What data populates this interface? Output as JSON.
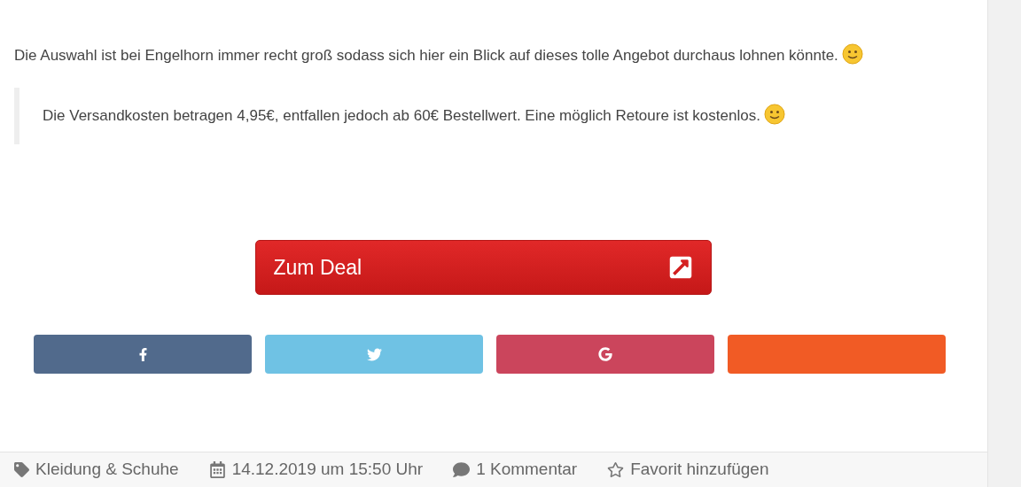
{
  "paragraph": {
    "text": "Die Auswahl ist bei Engelhorn immer recht groß sodass sich hier ein Blick auf dieses tolle Angebot durchaus lohnen könnte."
  },
  "quote": {
    "text": "Die Versandkosten betragen 4,95€, entfallen jedoch ab 60€ Bestellwert. Eine möglich Retoure ist kostenlos."
  },
  "deal_button": {
    "label": "Zum Deal"
  },
  "share_buttons": [
    {
      "kind": "facebook",
      "color": "#516a8c"
    },
    {
      "kind": "twitter",
      "color": "#6fc2e4"
    },
    {
      "kind": "google",
      "color": "#cb455c"
    },
    {
      "kind": "plain",
      "color": "#f15b25"
    }
  ],
  "meta": [
    {
      "kind": "tag",
      "text": "Kleidung & Schuhe"
    },
    {
      "kind": "date",
      "text": "14.12.2019 um 15:50 Uhr"
    },
    {
      "kind": "comments",
      "text": "1 Kommentar"
    },
    {
      "kind": "favorite",
      "text": "Favorit hinzufügen"
    }
  ]
}
